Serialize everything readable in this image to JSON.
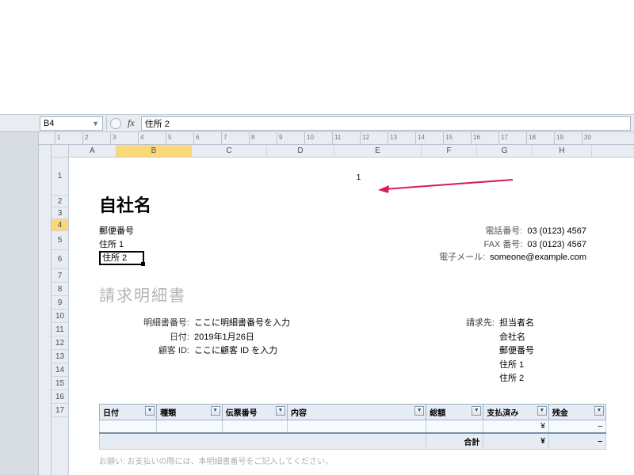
{
  "formula_bar": {
    "cell_ref": "B4",
    "fx_label": "fx",
    "value": "住所 2"
  },
  "ruler_ticks": [
    "1",
    "2",
    "3",
    "4",
    "5",
    "6",
    "7",
    "8",
    "9",
    "10",
    "11",
    "12",
    "13",
    "14",
    "15",
    "16",
    "17",
    "18",
    "19",
    "20"
  ],
  "columns": [
    {
      "label": "A",
      "w": 60
    },
    {
      "label": "B",
      "w": 95,
      "active": true
    },
    {
      "label": "C",
      "w": 95
    },
    {
      "label": "D",
      "w": 85
    },
    {
      "label": "E",
      "w": 110
    },
    {
      "label": "F",
      "w": 70
    },
    {
      "label": "G",
      "w": 70
    },
    {
      "label": "H",
      "w": 75
    }
  ],
  "rows": [
    "1",
    "2",
    "3",
    "4",
    "5",
    "6",
    "7",
    "8",
    "9",
    "10",
    "11",
    "12",
    "13",
    "14",
    "15",
    "16",
    "17"
  ],
  "active_row": "4",
  "page_number": "1",
  "company_name": "自社名",
  "sender": {
    "postal": "郵便番号",
    "addr1": "住所 1",
    "addr2": "住所 2"
  },
  "contact": {
    "tel_label": "電話番号:",
    "tel": "03 (0123) 4567",
    "fax_label": "FAX 番号:",
    "fax": "03 (0123) 4567",
    "mail_label": "電子メール:",
    "mail": "someone@example.com"
  },
  "section_title": "請求明細書",
  "meta": {
    "stmt_no_label": "明細書番号:",
    "stmt_no": "ここに明細書番号を入力",
    "date_label": "日付:",
    "date": "2019年1月26日",
    "cust_id_label": "顧客 ID:",
    "cust_id": "ここに顧客 ID を入力"
  },
  "billto": {
    "label": "請求先:",
    "contact": "担当者名",
    "company": "会社名",
    "postal": "郵便番号",
    "addr1": "住所 1",
    "addr2": "住所 2"
  },
  "table": {
    "headers": [
      "日付",
      "種類",
      "伝票番号",
      "内容",
      "総額",
      "支払済み",
      "残金"
    ],
    "currency": "¥",
    "dash": "–",
    "total_label": "合計"
  },
  "footnote": "お願い: お支払いの際には、本明細書番号をご記入してください。"
}
